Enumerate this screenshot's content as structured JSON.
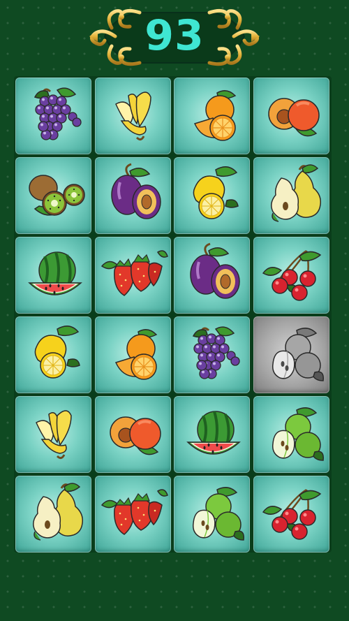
{
  "header": {
    "score": "93"
  },
  "board": {
    "rows": 6,
    "cols": 4,
    "tiles": [
      {
        "fruit": "grapes",
        "state": "active"
      },
      {
        "fruit": "banana",
        "state": "active"
      },
      {
        "fruit": "orange",
        "state": "active"
      },
      {
        "fruit": "peach",
        "state": "active"
      },
      {
        "fruit": "kiwi",
        "state": "active"
      },
      {
        "fruit": "plum",
        "state": "active"
      },
      {
        "fruit": "lemon",
        "state": "active"
      },
      {
        "fruit": "pear",
        "state": "active"
      },
      {
        "fruit": "watermelon",
        "state": "active"
      },
      {
        "fruit": "strawberry",
        "state": "active"
      },
      {
        "fruit": "plum",
        "state": "active"
      },
      {
        "fruit": "cherry",
        "state": "active"
      },
      {
        "fruit": "lemon",
        "state": "active"
      },
      {
        "fruit": "orange",
        "state": "active"
      },
      {
        "fruit": "grapes",
        "state": "active"
      },
      {
        "fruit": "apple",
        "state": "disabled"
      },
      {
        "fruit": "banana",
        "state": "active"
      },
      {
        "fruit": "peach",
        "state": "active"
      },
      {
        "fruit": "watermelon",
        "state": "active"
      },
      {
        "fruit": "apple",
        "state": "active"
      },
      {
        "fruit": "pear",
        "state": "active"
      },
      {
        "fruit": "strawberry",
        "state": "active"
      },
      {
        "fruit": "apple",
        "state": "active"
      },
      {
        "fruit": "cherry",
        "state": "active"
      }
    ]
  },
  "colors": {
    "background": "#0f4a22",
    "tile": "#7ad2c4",
    "score": "#3fe6d2",
    "ornament": "#e8c04a"
  }
}
